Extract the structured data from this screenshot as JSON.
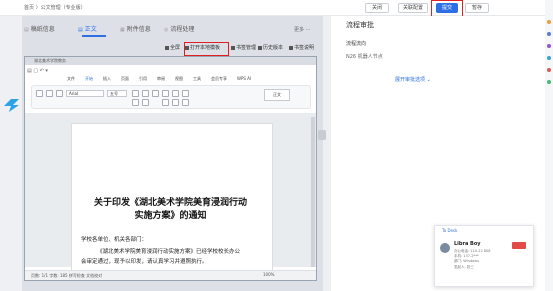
{
  "breadcrumb": "首页 〉公文管理（专业版）",
  "top_buttons": {
    "close": "关闭",
    "related": "关联配置",
    "submit": "提交",
    "save": "暂存"
  },
  "tabs": [
    {
      "label": "稿纸信息",
      "icon": "document-icon"
    },
    {
      "label": "正文",
      "icon": "document-icon"
    },
    {
      "label": "附件信息",
      "icon": "attachment-icon"
    },
    {
      "label": "流程处理",
      "icon": "flow-icon"
    }
  ],
  "more_label": "更多 ···",
  "doc_toolbar": {
    "fullscreen": "全屏",
    "open_local": "打开本地模板",
    "signature_mgmt": "书签管理",
    "history": "历史版本",
    "desc": "书签说明"
  },
  "docwin": {
    "title": "湖北美术学院教务",
    "quick": "▤ ▢ ↶ ▾",
    "ribbon_tabs": [
      "文件",
      "开始",
      "插入",
      "页面",
      "引用",
      "审阅",
      "视图",
      "工具",
      "会员专享",
      "WPS AI"
    ],
    "font": "Arial",
    "size": "五号",
    "style": "正文",
    "title_line1": "关于印发《湖北美术学院美育浸润行动",
    "title_line2": "实施方案》的通知",
    "para1": "学校各单位、机关各部门：",
    "para2": "《湖北美术学院美育浸润行动实施方案》已经学校校长办公",
    "para3": "会审定通过，现予以印发，请认真学习并遵照执行。",
    "status": "页数: 1/1   字数: 185   拼写检查   文档校对",
    "zoom": "100%"
  },
  "right_panel": {
    "title": "流程审批",
    "flow_label": "流程流向",
    "flow_value": "N26 机器人节点",
    "expand_link": "展开审批选项 ⌄"
  },
  "chat": {
    "header": "To Desk",
    "name": "Libra Boy",
    "line1": "办公电话: 110-22 808",
    "line2": "手机: 137-2***",
    "line3": "部门: Windows",
    "line4": "发起人: 张三"
  },
  "colors": {
    "accent": "#2f6fe4",
    "highlight": "#e02020"
  }
}
